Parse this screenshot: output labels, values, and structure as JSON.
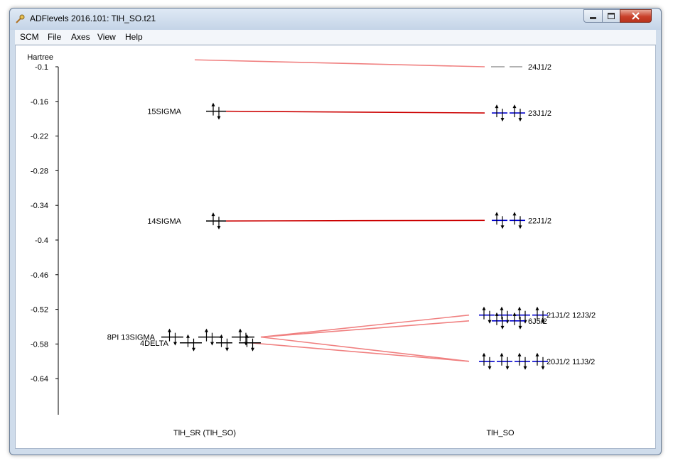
{
  "window": {
    "title": "ADFlevels 2016.101: TlH_SO.t21",
    "controls": {
      "minimize": "minimize",
      "maximize": "maximize",
      "close": "close"
    }
  },
  "menu": [
    {
      "label": "SCM"
    },
    {
      "label": "File"
    },
    {
      "label": "Axes"
    },
    {
      "label": "View"
    },
    {
      "label": "Help"
    }
  ],
  "chart_data": {
    "type": "energy-level-diagram",
    "ylabel": "Hartree",
    "yticks": [
      "-0.1",
      "-0.16",
      "-0.22",
      "-0.28",
      "-0.34",
      "-0.4",
      "-0.46",
      "-0.52",
      "-0.58",
      "-0.64"
    ],
    "ytick_values": [
      -0.1,
      -0.16,
      -0.22,
      -0.28,
      -0.34,
      -0.4,
      -0.46,
      -0.52,
      -0.58,
      -0.64
    ],
    "yrange": [
      -0.7,
      -0.085
    ],
    "columns": [
      {
        "name": "TlH_SR (TlH_SO)"
      },
      {
        "name": "TlH_SO"
      }
    ],
    "left_levels": [
      {
        "label": "15SIGMA",
        "energy": -0.177,
        "occupation": 2
      },
      {
        "label": "14SIGMA",
        "energy": -0.367,
        "occupation": 2
      },
      {
        "label": "8PI 13SIGMA",
        "energy": -0.568,
        "occupation": 2
      },
      {
        "label": "4DELTA",
        "energy": -0.578,
        "occupation": 2
      }
    ],
    "right_levels": [
      {
        "label": "24J1/2",
        "energy": -0.1,
        "occupation": 0
      },
      {
        "label": "23J1/2",
        "energy": -0.18,
        "occupation": 2
      },
      {
        "label": "22J1/2",
        "energy": -0.366,
        "occupation": 2
      },
      {
        "label": "21J1/2 12J3/2",
        "energy": -0.53,
        "occupation": 2
      },
      {
        "label": "6J5/2",
        "energy": -0.54,
        "occupation": 2
      },
      {
        "label": "20J1/2 11J3/2",
        "energy": -0.61,
        "occupation": 2
      }
    ],
    "colors": {
      "occupied_connector": "#cc0000",
      "mixed_connector": "#f08080",
      "occupied_left_level": "#000000",
      "occupied_right_level": "#0000cc",
      "virtual_level": "#999999"
    }
  }
}
